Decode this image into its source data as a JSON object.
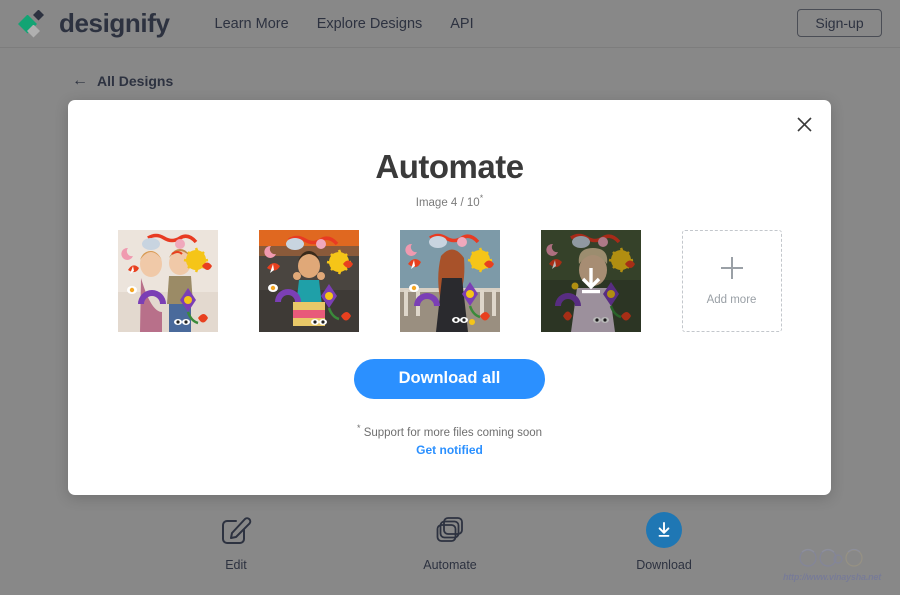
{
  "header": {
    "brand_name": "designify",
    "logo_icon": "sparkle-diamond-icon",
    "nav_links": [
      {
        "label": "Learn More"
      },
      {
        "label": "Explore Designs"
      },
      {
        "label": "API"
      }
    ],
    "signup_label": "Sign-up"
  },
  "back_nav": {
    "arrow_icon": "arrow-left-icon",
    "label": "All Designs"
  },
  "modal": {
    "close_icon": "close-icon",
    "title": "Automate",
    "subtitle_text": "Image 4 / 10",
    "subtitle_marker": "*",
    "thumbnails": [
      {
        "name": "thumbnail-1",
        "alt": "two children decorated with stickers",
        "state": "normal"
      },
      {
        "name": "thumbnail-2",
        "alt": "child in striped dress decorated with stickers",
        "state": "normal"
      },
      {
        "name": "thumbnail-3",
        "alt": "girl by fence decorated with stickers",
        "state": "normal"
      },
      {
        "name": "thumbnail-4",
        "alt": "child in garden decorated with stickers",
        "state": "hover-download"
      }
    ],
    "download_overlay_icon": "download-arrow-icon",
    "add_more": {
      "plus_icon": "plus-icon",
      "label": "Add more"
    },
    "download_all_label": "Download all",
    "footnote_marker": "*",
    "footnote_text": "Support for more files coming soon",
    "get_notified_label": "Get notified"
  },
  "toolbar": [
    {
      "icon": "edit-pencil-icon",
      "label": "Edit",
      "active": false
    },
    {
      "icon": "layers-stack-icon",
      "label": "Automate",
      "active": false
    },
    {
      "icon": "download-circle-icon",
      "label": "Download",
      "active": true
    }
  ],
  "watermark": {
    "text": "http://www.vinaysha.net",
    "icon": "decorative-emblem-icon"
  },
  "colors": {
    "page_background": "#888888",
    "modal_background": "#ffffff",
    "accent_blue": "#2b90ff",
    "download_circle_blue": "#1f77b4",
    "brand_green": "#13a474",
    "text_dark": "#2d3240"
  }
}
